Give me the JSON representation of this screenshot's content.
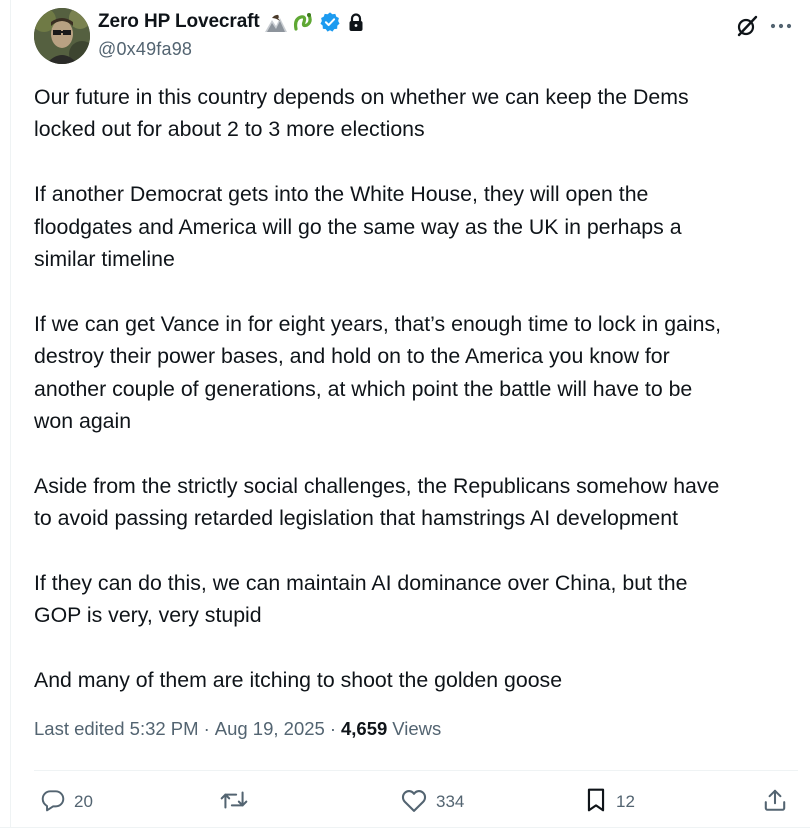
{
  "author": {
    "display_name": "Zero HP Lovecraft",
    "handle": "@0x49fa98",
    "name_icons": [
      "eagle-mountain-icon",
      "green-squiggle-icon",
      "verified-badge-icon",
      "lock-icon"
    ]
  },
  "top_actions": [
    "grok-icon",
    "more-options-icon"
  ],
  "tweet": {
    "paragraphs": [
      "Our future in this country depends on whether we can keep the Dems\nlocked out for about 2 to 3 more elections",
      "If another Democrat gets into the White House, they will open the\nfloodgates and America will go the same way as the UK in perhaps a\nsimilar timeline",
      "If we can get Vance in for eight years, that’s enough time to lock in gains,\ndestroy their power bases, and hold on to the America you know for\nanother couple of generations, at which point the battle will have to be\nwon again",
      "Aside from the strictly social challenges, the Republicans somehow have\nto avoid passing retarded legislation that hamstrings AI development",
      "If they can do this, we can maintain AI dominance over China, but the\nGOP is very, very stupid",
      "And many of them are itching to shoot the golden goose"
    ]
  },
  "meta": {
    "edited": "Last edited 5:32 PM",
    "separator": "·",
    "date": "Aug 19, 2025",
    "views_count": "4,659",
    "views_label": "Views"
  },
  "actions": {
    "reply": {
      "icon": "reply-icon",
      "count": "20"
    },
    "repost": {
      "icon": "repost-icon",
      "count": ""
    },
    "like": {
      "icon": "like-icon",
      "count": "334"
    },
    "bookmark": {
      "icon": "bookmark-icon",
      "count": "12"
    },
    "share": {
      "icon": "share-icon",
      "count": ""
    }
  },
  "colors": {
    "text_primary": "#0f1419",
    "text_secondary": "#536471",
    "verified_blue": "#1d9bf0",
    "divider": "#eff3f4"
  }
}
